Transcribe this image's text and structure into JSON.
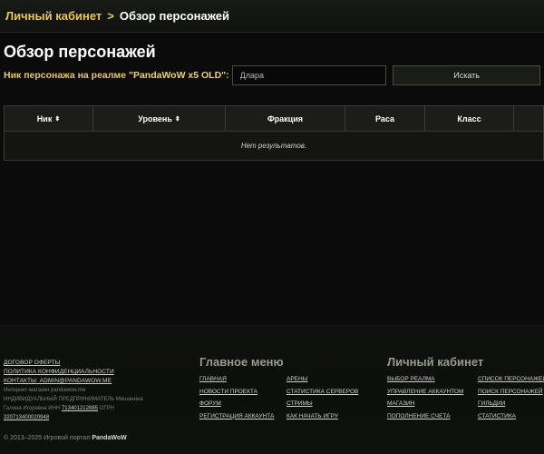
{
  "breadcrumb": {
    "parent": "Личный кабинет",
    "separator": ">",
    "current": "Обзор персонажей"
  },
  "page": {
    "title": "Обзор персонажей"
  },
  "search": {
    "label_prefix": "Ник персонажа на реалме ",
    "realm": "\"PandaWoW x5 OLD\"",
    "label_suffix": ":",
    "value": "Длара",
    "button": "Искать"
  },
  "table": {
    "columns": [
      {
        "label": "Ник",
        "sortable": true
      },
      {
        "label": "Уровень",
        "sortable": true
      },
      {
        "label": "Фракция",
        "sortable": false
      },
      {
        "label": "Раса",
        "sortable": false
      },
      {
        "label": "Класс",
        "sortable": false
      },
      {
        "label": "",
        "sortable": false
      }
    ],
    "sort_icon": "⬍",
    "empty_text": "Нет результатов."
  },
  "footer": {
    "links": {
      "offer": "ДОГОВОР ОФЕРТЫ",
      "privacy": "ПОЛИТИКА КОНФИДЕНЦИАЛЬНОСТИ",
      "contacts": "КОНТАКТЫ: ADMIN@PANDAWOW.ME"
    },
    "legal_line1": "Интернет-магазин pandawow.me",
    "legal_line2": "ИНДИВИДУАЛЬНЫЙ ПРЕДПРИНИМАТЕЛЬ Мишанина",
    "legal_line3_prefix": "Галина Игоревна ИНН ",
    "inn": "713401212885",
    "legal_line3_suffix": " ОГРН",
    "ogrn": "320713400020948",
    "copyright_prefix": "© 2013–2025 Игровой портал ",
    "copyright_brand": "PandaWoW",
    "main_menu": {
      "title": "Главное меню",
      "col_a": [
        "ГЛАВНАЯ",
        "НОВОСТИ ПРОЕКТА",
        "ФОРУМ",
        "РЕГИСТРАЦИЯ АККАУНТА"
      ],
      "col_b": [
        "АРЕНЫ",
        "СТАТИСТИКА СЕРВЕРОВ",
        "СТРИМЫ",
        "КАК НАЧАТЬ ИГРУ"
      ]
    },
    "cabinet": {
      "title": "Личный кабинет",
      "col_a": [
        "ВЫБОР РЕАЛМА",
        "УПРАВЛЕНИЕ АККАУНТОМ",
        "МАГАЗИН",
        "ПОПОЛНЕНИЕ СЧЕТА"
      ],
      "col_b": [
        "СПИСОК ПЕРСОНАЖЕЙ",
        "ПОИСК ПЕРСОНАЖЕЙ",
        "ГИЛЬДИИ",
        "СТАТИСТИКА"
      ]
    }
  }
}
